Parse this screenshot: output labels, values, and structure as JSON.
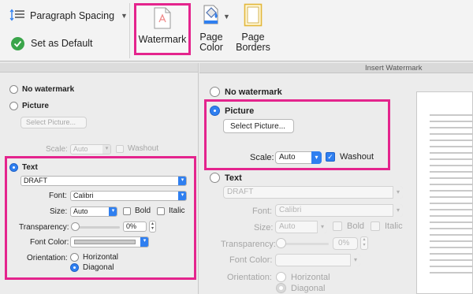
{
  "ribbon": {
    "paragraph_spacing": "Paragraph Spacing",
    "set_as_default": "Set as Default",
    "watermark": "Watermark",
    "page_color": "Page\nColor",
    "page_borders": "Page\nBorders"
  },
  "left_dialog": {
    "no_watermark": "No watermark",
    "picture": "Picture",
    "select_picture": "Select Picture...",
    "scale_label": "Scale:",
    "scale_value": "Auto",
    "washout": "Washout",
    "text": "Text",
    "text_value": "DRAFT",
    "font_label": "Font:",
    "font_value": "Calibri",
    "size_label": "Size:",
    "size_value": "Auto",
    "bold": "Bold",
    "italic": "Italic",
    "transparency_label": "Transparency:",
    "transparency_value": "0%",
    "font_color_label": "Font Color:",
    "orientation_label": "Orientation:",
    "horizontal": "Horizontal",
    "diagonal": "Diagonal"
  },
  "right_dialog": {
    "title": "Insert Watermark",
    "no_watermark": "No watermark",
    "picture": "Picture",
    "select_picture": "Select Picture...",
    "scale_label": "Scale:",
    "scale_value": "Auto",
    "washout": "Washout",
    "text": "Text",
    "text_value": "DRAFT",
    "font_label": "Font:",
    "font_value": "Calibri",
    "size_label": "Size:",
    "size_value": "Auto",
    "bold": "Bold",
    "italic": "Italic",
    "transparency_label": "Transparency:",
    "transparency_value": "0%",
    "font_color_label": "Font Color:",
    "orientation_label": "Orientation:",
    "horizontal": "Horizontal",
    "diagonal": "Diagonal"
  },
  "colors": {
    "highlight": "#e4248d",
    "accent": "#2f7ff0",
    "check_green": "#3aa54a"
  },
  "icons": [
    "paragraph-spacing-icon",
    "check-circle-icon",
    "watermark-icon",
    "page-color-icon",
    "page-borders-icon"
  ]
}
